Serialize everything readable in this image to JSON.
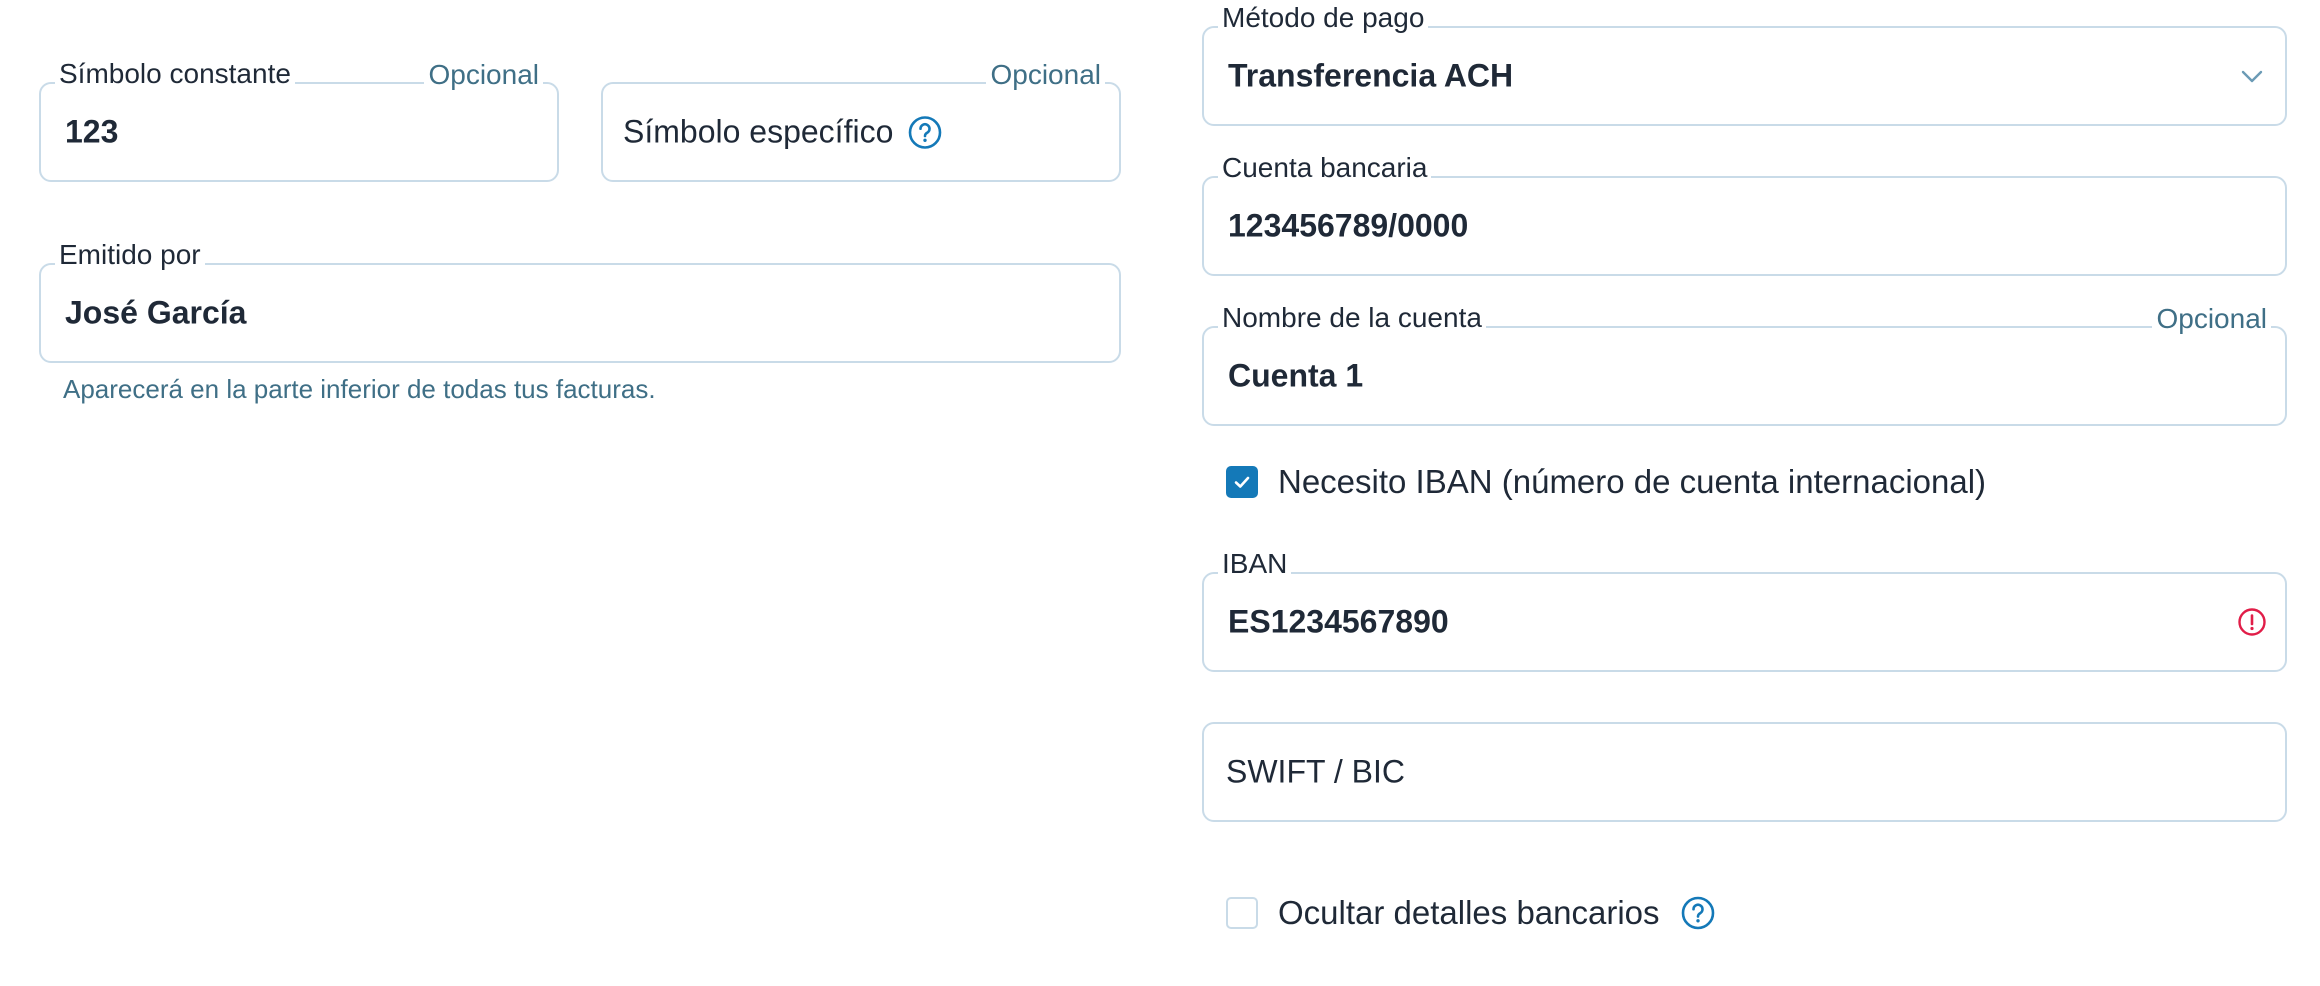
{
  "left": {
    "constant_symbol": {
      "label": "Símbolo constante",
      "optional": "Opcional",
      "value": "123"
    },
    "specific_symbol": {
      "optional": "Opcional",
      "placeholder": "Símbolo específico",
      "help_icon": "question-circle-icon"
    },
    "issued_by": {
      "label": "Emitido por",
      "value": "José García",
      "helper": "Aparecerá en la parte inferior de todas tus facturas."
    }
  },
  "right": {
    "payment_method": {
      "label": "Método de pago",
      "value": "Transferencia ACH",
      "icon": "chevron-down-icon"
    },
    "bank_account": {
      "label": "Cuenta bancaria",
      "value": "123456789/0000"
    },
    "account_name": {
      "label": "Nombre de la cuenta",
      "optional": "Opcional",
      "value": "Cuenta 1"
    },
    "need_iban": {
      "label": "Necesito IBAN (número de cuenta internacional)",
      "checked": true
    },
    "iban": {
      "label": "IBAN",
      "value": "ES1234567890",
      "icon": "error-circle-icon"
    },
    "swift": {
      "placeholder": "SWIFT / BIC"
    },
    "hide_bank_details": {
      "label": "Ocultar detalles bancarios",
      "checked": false,
      "help_icon": "question-circle-icon"
    }
  },
  "colors": {
    "border": "#c9dbe8",
    "accent": "#1479b8",
    "muted_text": "#3f6f86",
    "error": "#e11d48"
  }
}
